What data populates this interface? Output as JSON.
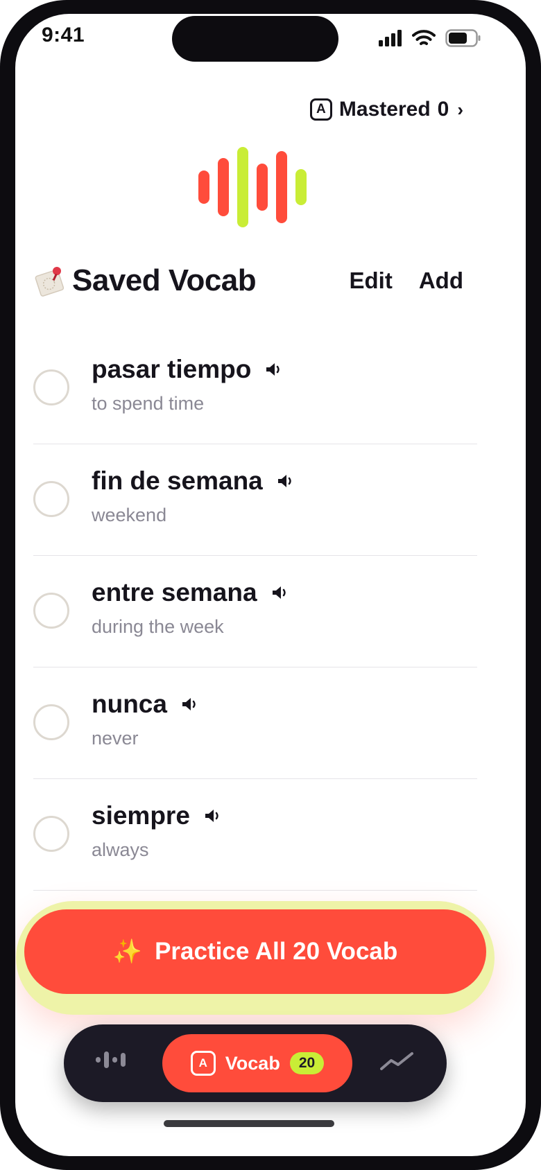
{
  "status": {
    "time": "9:41"
  },
  "mastered": {
    "badge": "A",
    "label": "Mastered",
    "count": "0",
    "chevron": "›"
  },
  "section": {
    "title": "Saved Vocab",
    "edit_label": "Edit",
    "add_label": "Add",
    "icon": "notepad-pin-icon"
  },
  "vocab": [
    {
      "word": "pasar tiempo",
      "meaning": "to spend time"
    },
    {
      "word": "fin de semana",
      "meaning": "weekend"
    },
    {
      "word": "entre semana",
      "meaning": "during the week"
    },
    {
      "word": "nunca",
      "meaning": "never"
    },
    {
      "word": "siempre",
      "meaning": "always"
    }
  ],
  "practice": {
    "sparkle": "✨",
    "label": "Practice All 20 Vocab"
  },
  "tabs": {
    "active_badge": "A",
    "active_label": "Vocab",
    "active_count": "20"
  },
  "colors": {
    "accent": "#ff4c3b",
    "lime": "#c9ed36",
    "dark": "#1c1a26",
    "muted": "#8a8894"
  }
}
